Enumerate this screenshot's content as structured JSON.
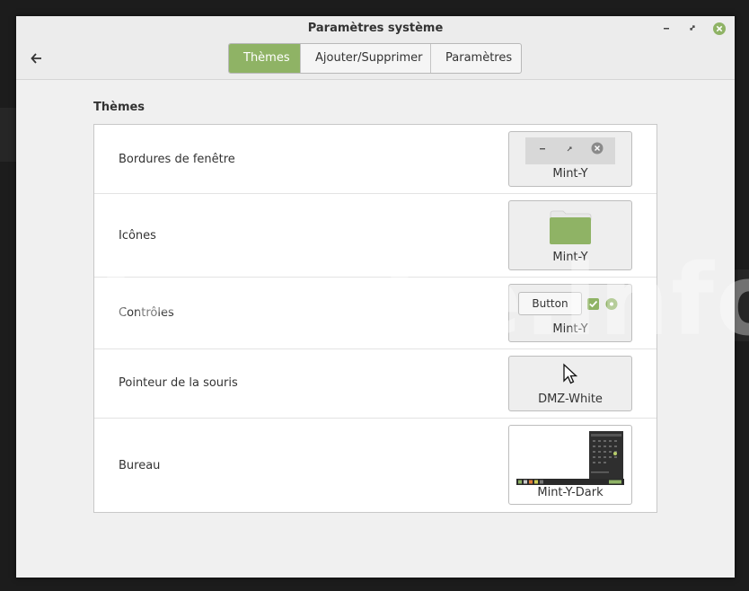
{
  "window": {
    "title": "Paramètres système"
  },
  "tabs": [
    {
      "label": "Thèmes",
      "active": true
    },
    {
      "label": "Ajouter/Supprimer",
      "active": false
    },
    {
      "label": "Paramètres",
      "active": false
    }
  ],
  "section": {
    "title": "Thèmes"
  },
  "rows": [
    {
      "label": "Bordures de fenêtre",
      "value": "Mint-Y"
    },
    {
      "label": "Icônes",
      "value": "Mint-Y"
    },
    {
      "label": "Contrôles",
      "value": "Mint-Y",
      "button_label": "Button"
    },
    {
      "label": "Pointeur de la souris",
      "value": "DMZ-White"
    },
    {
      "label": "Bureau",
      "value": "Mint-Y-Dark"
    }
  ],
  "watermark": "lecrabe.info",
  "colors": {
    "accent": "#8fb365",
    "close": "#8fb365"
  }
}
